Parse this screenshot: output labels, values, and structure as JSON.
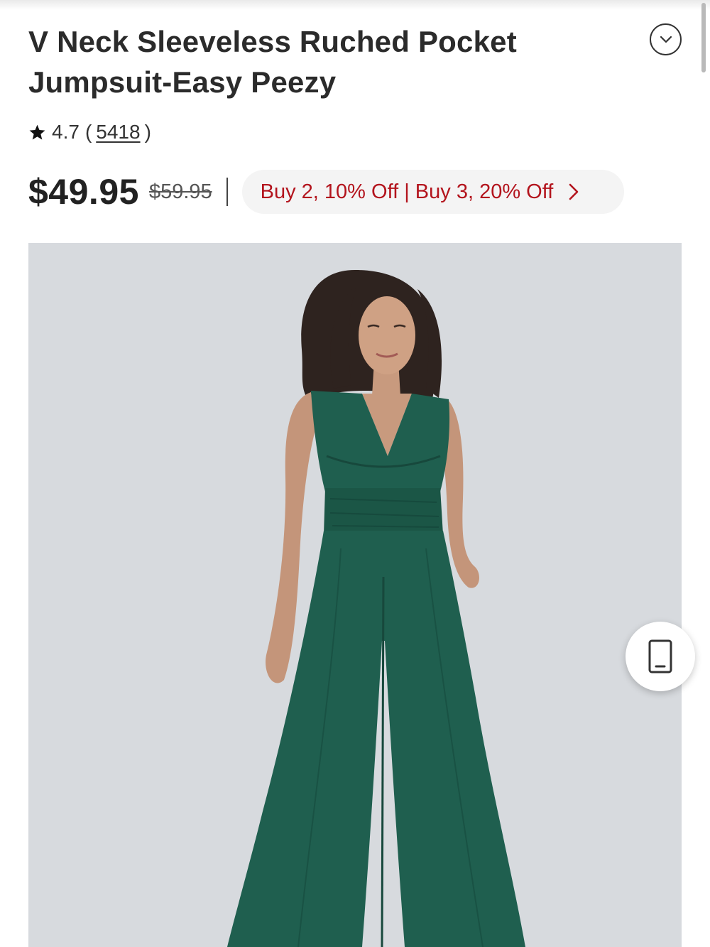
{
  "product": {
    "title_line1": "V Neck Sleeveless Ruched Pocket",
    "title_line2": "Jumpsuit-Easy Peezy",
    "rating": "4.7",
    "rating_open": "(",
    "review_count": "5418",
    "rating_close": ")",
    "price": "$49.95",
    "original_price": "$59.95",
    "promo_text": "Buy 2, 10% Off | Buy 3, 20% Off"
  },
  "icons": {
    "collapse": "chevron-down-icon",
    "rating": "star-icon",
    "promo": "chevron-right-icon",
    "floating": "phone-icon"
  },
  "colors": {
    "promo_text": "#b3141d",
    "image_background": "#d7dade",
    "jumpsuit": "#1f5f4f"
  }
}
